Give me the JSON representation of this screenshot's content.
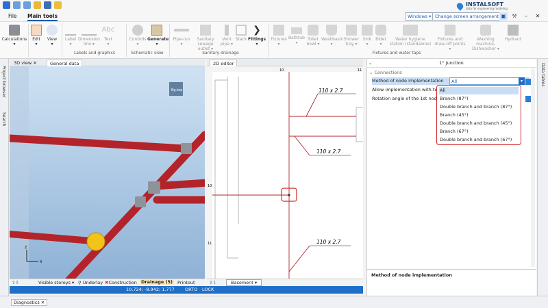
{
  "titlebar": {
    "brand": "INSTALSOFT",
    "brand_sub": "data for engineering modeling",
    "windows_label": "Windows",
    "arrangement_label": "Change screen arrangement"
  },
  "menu": {
    "file": "File",
    "main_tools": "Main tools"
  },
  "ribbon": {
    "calculations": "Calculations",
    "edit": "Edit",
    "view": "View",
    "label": "Label",
    "dimension_line": "Dimension line",
    "text": "Text",
    "group_labels": "Labels and graphics",
    "controls": "Controls",
    "generate": "Generate",
    "group_schematic": "Schematic view",
    "pipe_run": "Pipe-run",
    "sanitary_sewage_outlet": "Sanitary sewage outlet",
    "vent_pipe": "Vent pipe",
    "stack": "Stack",
    "fittings": "Fittings",
    "group_sanitary": "Sanitary drainage",
    "fixtures": "Fixtures",
    "bathtub": "Bathtub",
    "toilet_bowl": "Toilet bowl",
    "washbasin": "Washbasin",
    "shower_tray": "Shower tray",
    "sink": "Sink",
    "bidet": "Bidet",
    "water_hygiene": "Water hygiene station (standalone)",
    "fixtures_drawoff": "Fixtures and draw-off points",
    "washing_machine": "Washing machine, Dishwasher",
    "hydrant": "Hydrant",
    "group_fixtures": "Fixtures and water taps"
  },
  "left_strip": {
    "project_browser": "Project browser",
    "search": "Search"
  },
  "panel3d": {
    "tab_3d": "3D view",
    "tab_general": "General data",
    "cube_label": "Bg.top",
    "bottom": {
      "visible_storeys": "Visible storeys",
      "underlay": "Underlay",
      "construction": "Construction",
      "drainage": "Drainage (5)",
      "printout": "Printout"
    }
  },
  "panel2d": {
    "tab": "2D editor",
    "ruler_x": "10",
    "ruler_x2": "11",
    "ruler_y": "10",
    "ruler_y2": "11",
    "labels": [
      "110 x 2.7",
      "110 x 2.7",
      "110 x 2.7"
    ],
    "basement": "Basement"
  },
  "status": {
    "coords": "10.724; -8.942; 1.777",
    "orto": "ORTO",
    "lock": "LOCK"
  },
  "right_panel": {
    "title": "1° Junction",
    "section": "Connections",
    "rows": [
      {
        "label": "Method of node implementation",
        "value": "All"
      },
      {
        "label": "Allow implementation with two fi",
        "value": ""
      },
      {
        "label": "Rotation angle of the 1st node (°",
        "value": ""
      }
    ],
    "dropdown": [
      "All",
      "Branch (87°)",
      "Double branch and branch (87°)",
      "Branch (45°)",
      "Double branch and branch (45°)",
      "Branch (67°)",
      "Double branch and branch (67°)"
    ],
    "description_title": "Method of node implementation"
  },
  "right_strip": {
    "data_tables": "Data tables"
  },
  "bottom": {
    "diagnostics": "Diagnostics"
  },
  "colors": {
    "accent": "#1e5aa8",
    "status_bar": "#1e6fc9",
    "highlight": "#d12b2b",
    "pipe": "#c0262a"
  }
}
